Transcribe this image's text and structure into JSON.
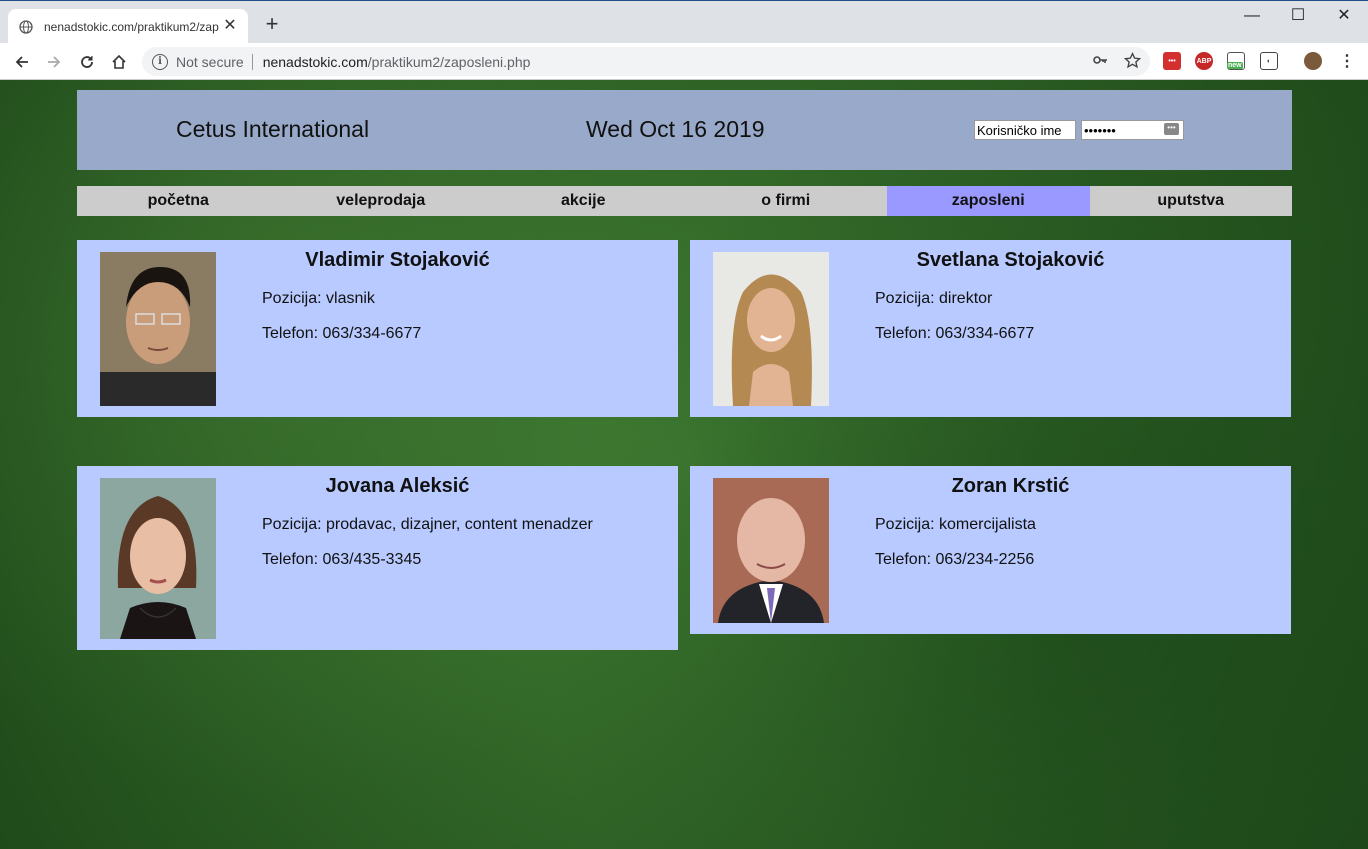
{
  "browser": {
    "tab_title": "nenadstokic.com/praktikum2/zap",
    "new_tab": "+",
    "security_label": "Not secure",
    "url_host": "nenadstokic.com",
    "url_path": "/praktikum2/zaposleni.php",
    "window_controls": {
      "minimize": "—",
      "maximize": "☐",
      "close": "✕"
    },
    "extensions": [
      "lastpass",
      "adblock-plus",
      "screenshot-new",
      "privacy-badger"
    ],
    "ext_abp_label": "ABP",
    "ext_new_label": "new"
  },
  "header": {
    "site_name": "Cetus International",
    "date": "Wed Oct 16 2019",
    "username_value": "Korisničko ime",
    "password_value": "•••••••"
  },
  "menu": {
    "items": [
      {
        "label": "početna"
      },
      {
        "label": "veleprodaja"
      },
      {
        "label": "akcije"
      },
      {
        "label": "o firmi"
      },
      {
        "label": "zaposleni",
        "active": true
      },
      {
        "label": "uputstva"
      }
    ]
  },
  "employees": [
    {
      "name": "Vladimir Stojaković",
      "position": "Pozicija: vlasnik",
      "phone": "Telefon: 063/334-6677"
    },
    {
      "name": "Svetlana Stojaković",
      "position": "Pozicija: direktor",
      "phone": "Telefon: 063/334-6677"
    },
    {
      "name": "Jovana Aleksić",
      "position": "Pozicija: prodavac, dizajner, content menadzer",
      "phone": "Telefon: 063/435-3345"
    },
    {
      "name": "Zoran Krstić",
      "position": "Pozicija: komercijalista",
      "phone": "Telefon: 063/234-2256"
    }
  ],
  "colors": {
    "header_bg": "#98a9c9",
    "menu_bg": "#cccccc",
    "menu_active": "#9999ff",
    "card_bg": "#b8caff",
    "page_bg": "#2d5a23"
  }
}
